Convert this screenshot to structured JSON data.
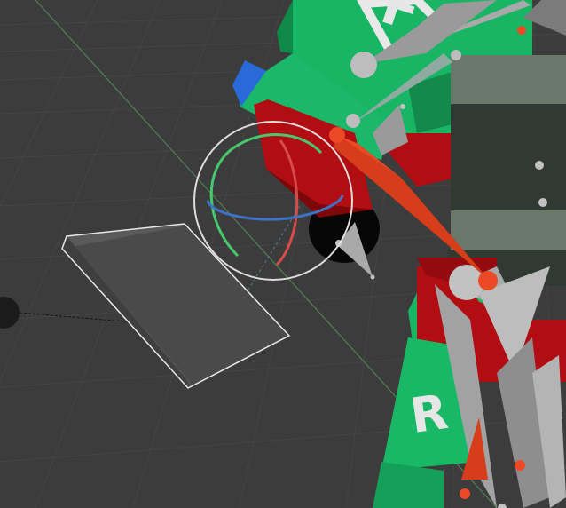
{
  "viewport": {
    "labels": {
      "upper_letter": "F",
      "lower_letter": "R"
    },
    "colors": {
      "background": "#3c3c3c",
      "grid": "#474747",
      "grid_minor": "#424242",
      "green_axis_line": "#4f7f55",
      "armor_green": "#18b564",
      "armor_red": "#b10d12",
      "bone_gray": "#a9a9a9",
      "selected_bone": "#d63d1a",
      "rotate_x": "#d84b4b",
      "rotate_y": "#48c86d",
      "rotate_z": "#3e72c7",
      "selection_outline": "#e8e8e8",
      "dark_panel": "#303a32",
      "gray_panel": "#6a776b"
    }
  }
}
